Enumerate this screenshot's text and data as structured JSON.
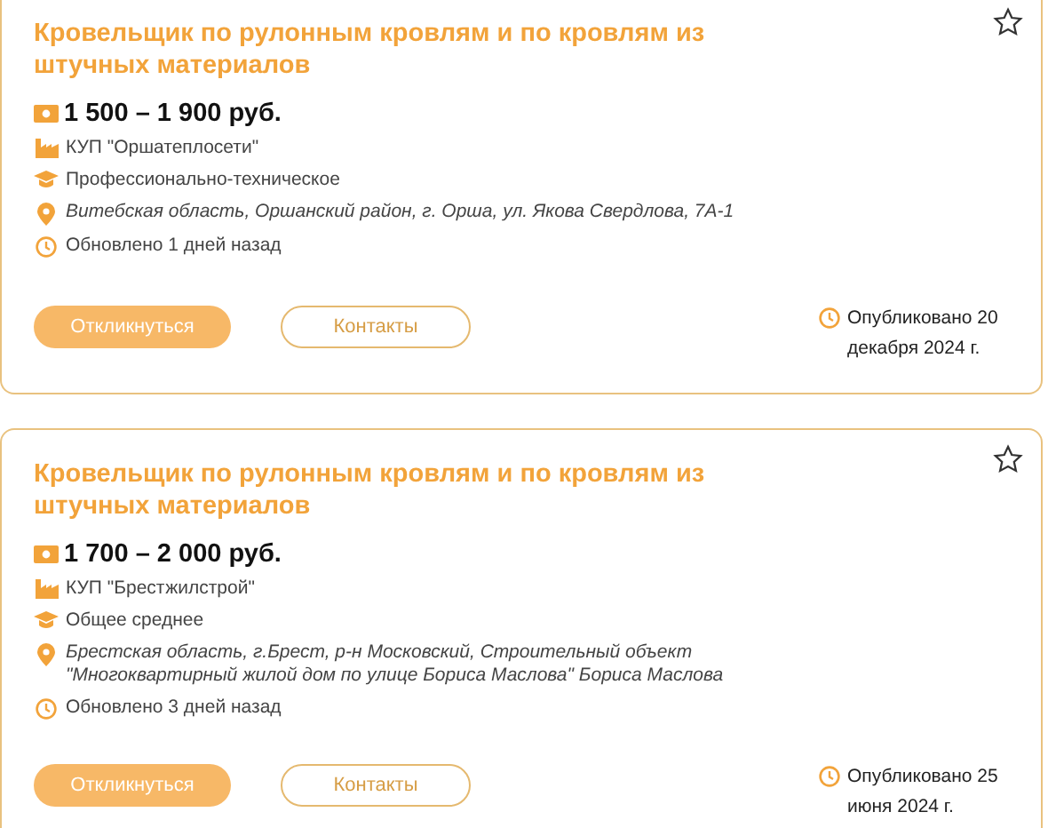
{
  "vacancies": [
    {
      "title": "Кровельщик по рулонным кровлям и по кровлям из штучных материалов",
      "favorite": false,
      "salary": "1 500 – 1 900 руб.",
      "company": "КУП \"Оршатеплосети\"",
      "education": "Профессионально-техническое",
      "address": "Витебская область, Оршанский район, г. Орша, ул. Якова Свердлова, 7А-1",
      "updated": "Обновлено 1 дней назад",
      "apply": "Откликнуться",
      "contacts": "Контакты",
      "published": "Опубликовано 20 декабря 2024 г."
    },
    {
      "title": "Кровельщик по рулонным кровлям и по кровлям из штучных материалов",
      "favorite": false,
      "salary": "1 700 – 2 000 руб.",
      "company": "КУП \"Брестжилстрой\"",
      "education": "Общее среднее",
      "address": "Брестская область, г.Брест, р-н Московский, Строительный объект \"Многоквартирный жилой дом по улице Бориса Маслова\" Бориса Маслова",
      "updated": "Обновлено 3 дней назад",
      "apply": "Откликнуться",
      "contacts": "Контакты",
      "published": "Опубликовано 25 июня 2024 г."
    }
  ]
}
